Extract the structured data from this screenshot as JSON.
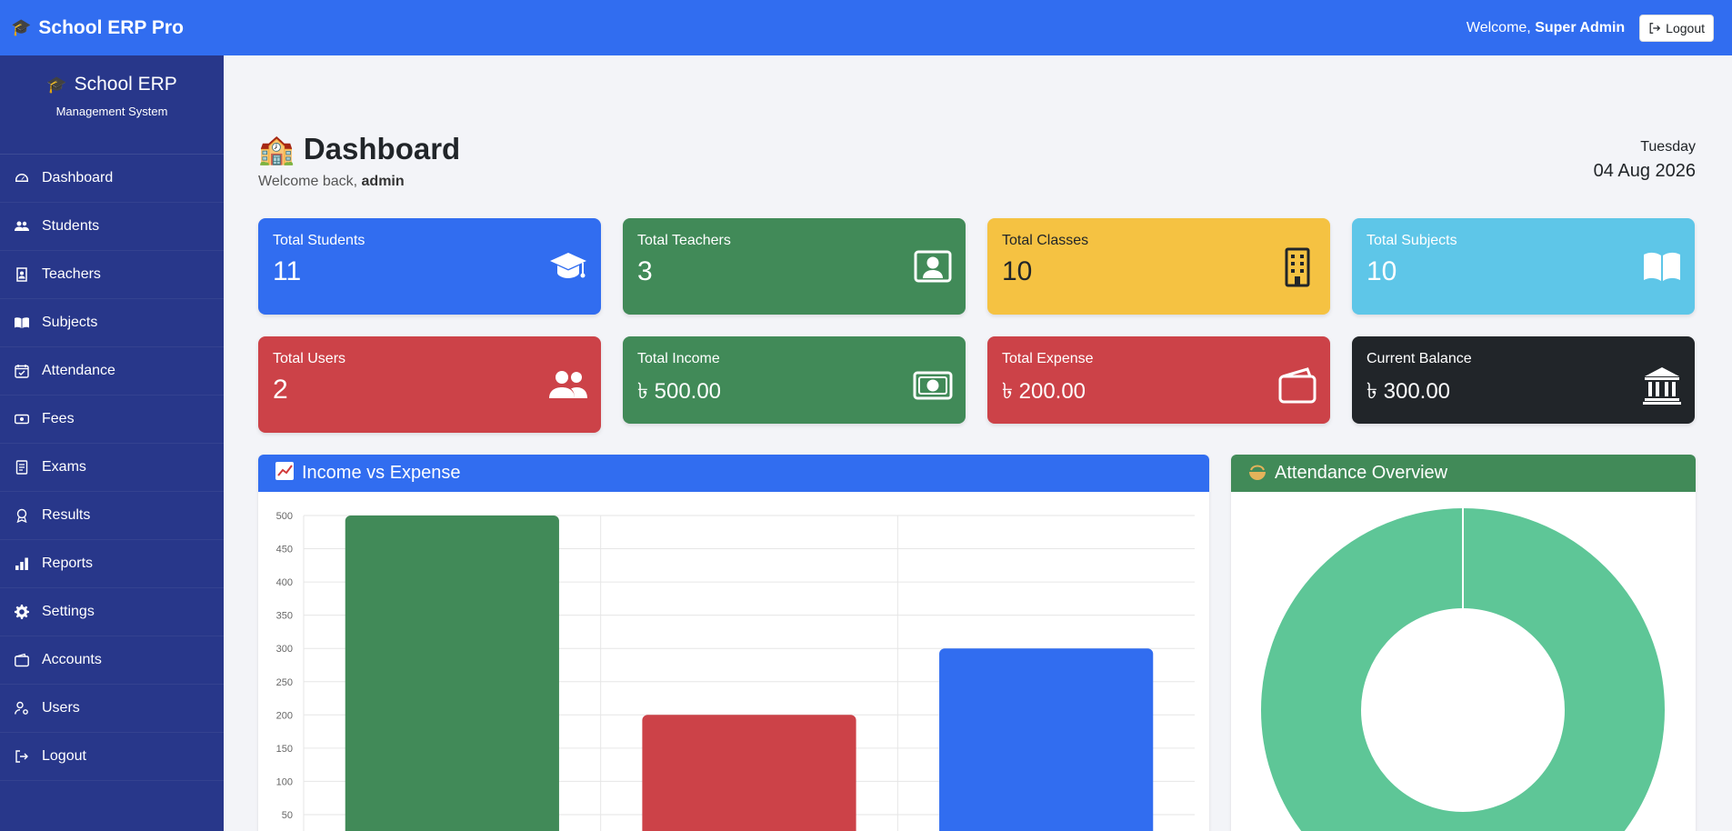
{
  "topbar": {
    "brand": "School ERP Pro",
    "welcome_prefix": "Welcome,",
    "user": "Super Admin",
    "logout": "Logout"
  },
  "sidebar": {
    "title": "School ERP",
    "subtitle": "Management System",
    "items": [
      {
        "label": "Dashboard",
        "icon": "dashboard-icon"
      },
      {
        "label": "Students",
        "icon": "students-icon"
      },
      {
        "label": "Teachers",
        "icon": "teacher-badge-icon"
      },
      {
        "label": "Subjects",
        "icon": "book-icon"
      },
      {
        "label": "Attendance",
        "icon": "calendar-check-icon"
      },
      {
        "label": "Fees",
        "icon": "cash-icon"
      },
      {
        "label": "Exams",
        "icon": "document-icon"
      },
      {
        "label": "Results",
        "icon": "award-icon"
      },
      {
        "label": "Reports",
        "icon": "bar-chart-icon"
      },
      {
        "label": "Settings",
        "icon": "gear-icon"
      },
      {
        "label": "Accounts",
        "icon": "wallet-icon"
      },
      {
        "label": "Users",
        "icon": "user-gear-icon"
      },
      {
        "label": "Logout",
        "icon": "logout-icon"
      }
    ]
  },
  "header": {
    "title": "Dashboard",
    "welcome_back": "Welcome back,",
    "username": "admin",
    "day": "Tuesday",
    "date": "04 Aug 2026"
  },
  "cards": [
    {
      "label": "Total Students",
      "value": "11",
      "color": "#316df0",
      "icon": "graduation-cap-icon"
    },
    {
      "label": "Total Teachers",
      "value": "3",
      "color": "#418a58",
      "icon": "teacher-board-icon"
    },
    {
      "label": "Total Classes",
      "value": "10",
      "color": "#f5c242",
      "icon": "building-icon"
    },
    {
      "label": "Total Subjects",
      "value": "10",
      "color": "#5ec6e8",
      "icon": "open-book-icon"
    },
    {
      "label": "Total Users",
      "value": "2",
      "color": "#cc4248",
      "icon": "users-icon"
    },
    {
      "label": "Total Income",
      "value": "৳ 500.00",
      "color": "#418a58",
      "icon": "cash-icon"
    },
    {
      "label": "Total Expense",
      "value": "৳ 200.00",
      "color": "#cc4248",
      "icon": "wallet-icon"
    },
    {
      "label": "Current Balance",
      "value": "৳ 300.00",
      "color": "#212529",
      "icon": "bank-icon"
    }
  ],
  "panels": {
    "income_expense": {
      "title": "Income vs Expense",
      "color": "#316df0"
    },
    "attendance": {
      "title": "Attendance Overview",
      "color": "#418a58"
    }
  },
  "chart_data": [
    {
      "type": "bar",
      "categories": [
        "",
        "",
        ""
      ],
      "values": [
        500,
        200,
        300
      ],
      "colors": [
        "#418a58",
        "#cc4248",
        "#316df0"
      ],
      "ylim": [
        0,
        500
      ],
      "yticks": [
        50,
        100,
        150,
        200,
        250,
        300,
        350,
        400,
        450,
        500
      ],
      "grid": true
    },
    {
      "type": "pie",
      "values": [
        100
      ],
      "colors": [
        "#5ec697"
      ]
    }
  ]
}
